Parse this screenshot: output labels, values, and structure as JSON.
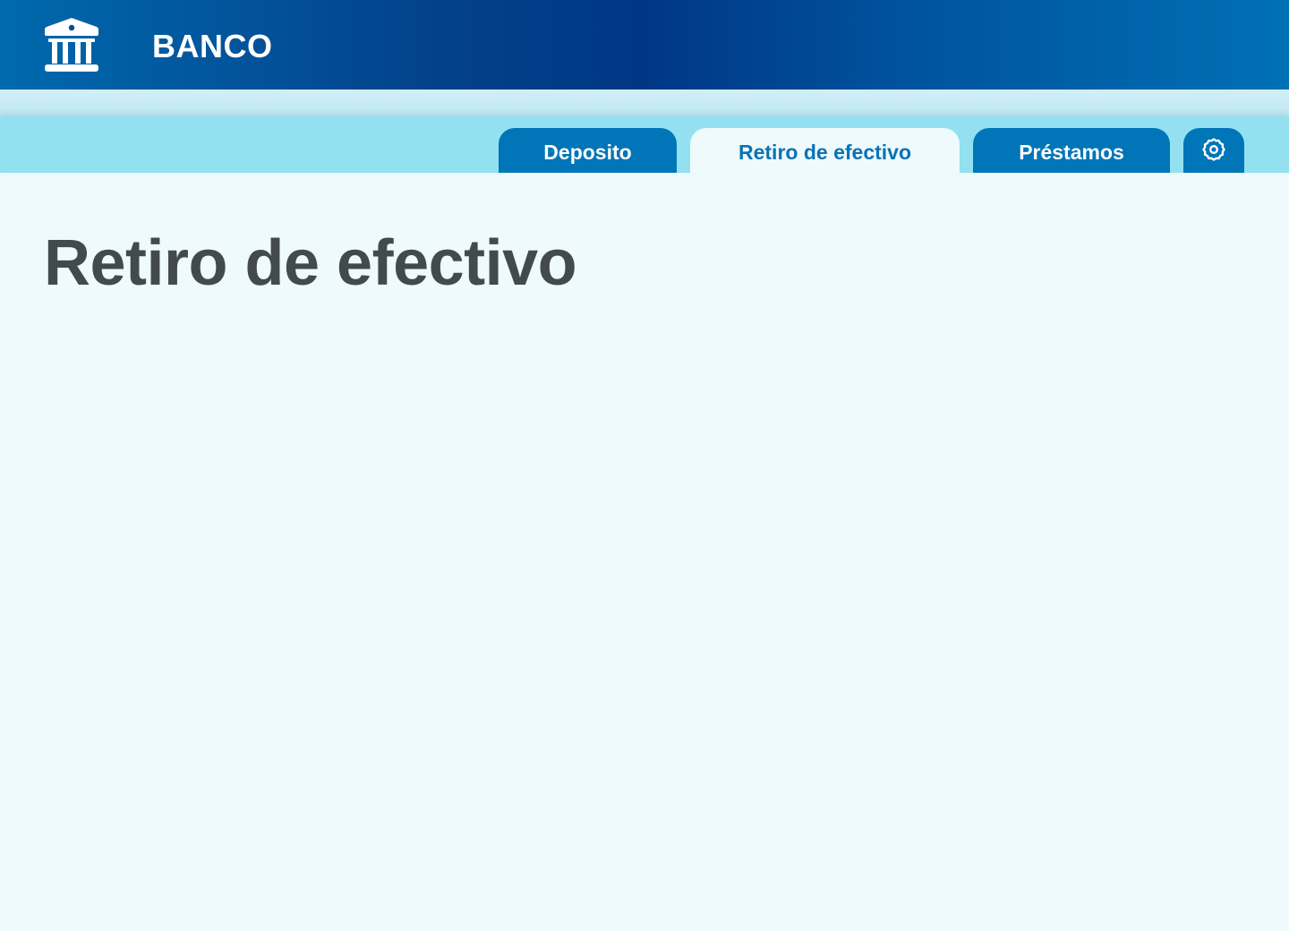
{
  "header": {
    "brand": "BANCO",
    "logo_icon": "bank-building-icon"
  },
  "nav": {
    "tabs": [
      {
        "label": "Deposito",
        "active": false
      },
      {
        "label": "Retiro de efectivo",
        "active": true
      },
      {
        "label": "Préstamos",
        "active": false
      }
    ],
    "settings_icon": "gear-icon"
  },
  "main": {
    "title": "Retiro de efectivo"
  },
  "colors": {
    "header_dark": "#003785",
    "header_light": "#0070b4",
    "nav_bg": "#93e1f0",
    "tab_bg": "#0075b8",
    "active_tab_text": "#0b72b5",
    "page_bg": "#eefafc",
    "title_text": "#424a50"
  }
}
